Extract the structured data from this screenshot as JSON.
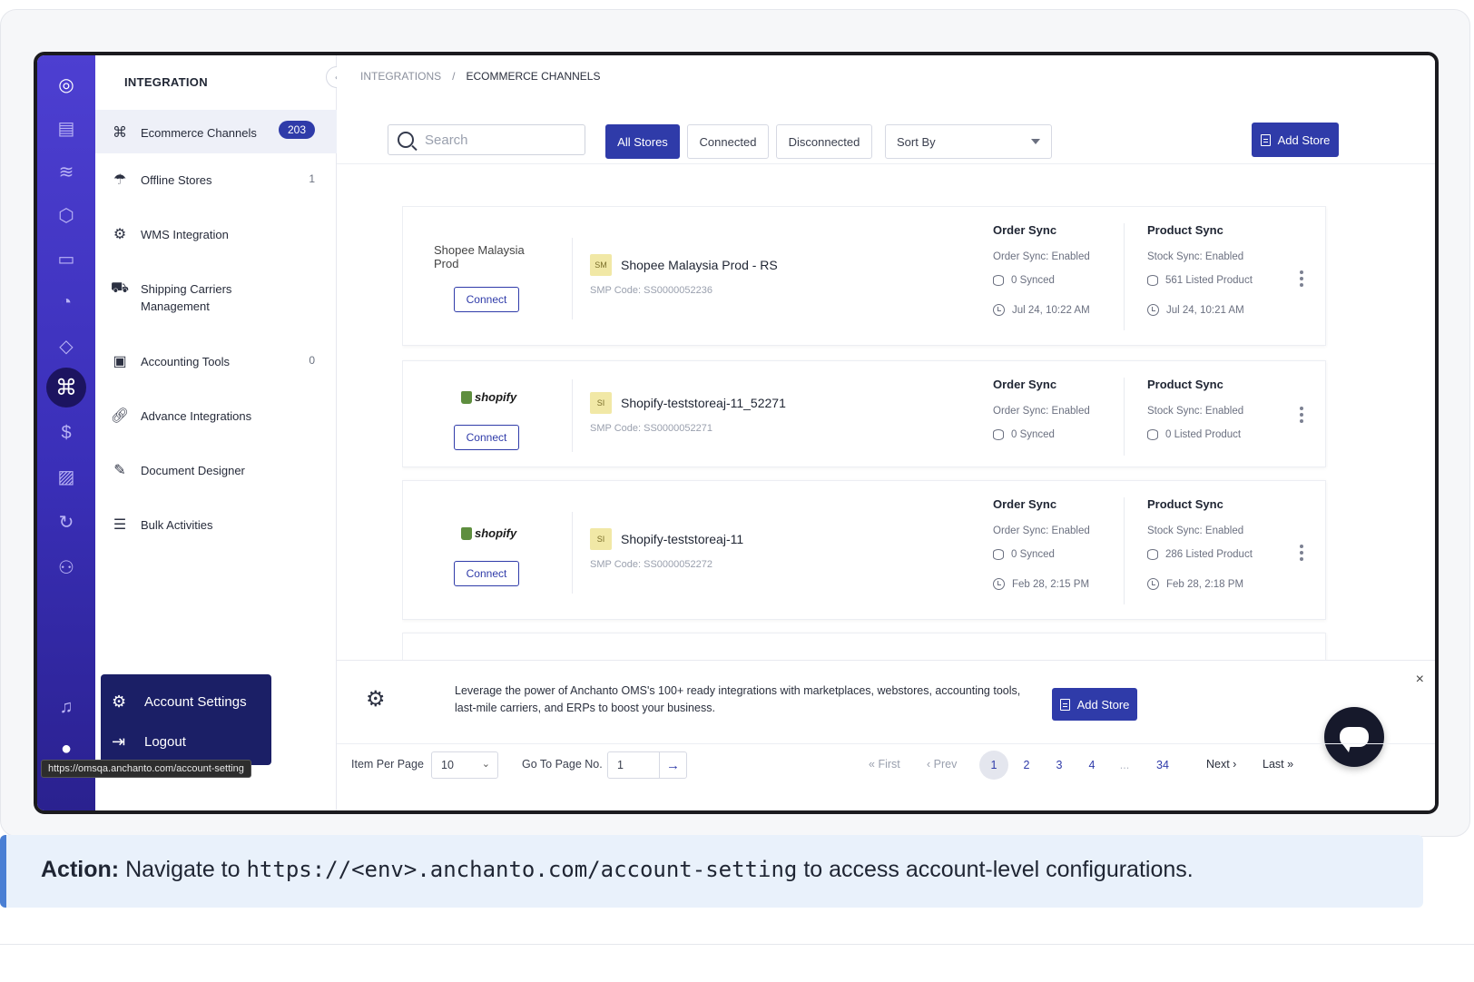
{
  "breadcrumb": {
    "root": "INTEGRATIONS",
    "separator": "/",
    "current": "ECOMMERCE CHANNELS"
  },
  "sidebar": {
    "title": "INTEGRATION",
    "items": [
      {
        "label": "Ecommerce Channels",
        "count": "203",
        "icon": "command-icon"
      },
      {
        "label": "Offline Stores",
        "count": "1",
        "icon": "umbrella-icon"
      },
      {
        "label": "WMS Integration",
        "count": "",
        "icon": "gear-icon"
      },
      {
        "label": "Shipping Carriers Management",
        "count": "",
        "icon": "truck-icon"
      },
      {
        "label": "Accounting Tools",
        "count": "0",
        "icon": "cash-icon"
      },
      {
        "label": "Advance Integrations",
        "count": "",
        "icon": "link-icon"
      },
      {
        "label": "Document Designer",
        "count": "",
        "icon": "edit-icon"
      },
      {
        "label": "Bulk Activities",
        "count": "",
        "icon": "list-icon"
      }
    ]
  },
  "account_menu": {
    "settings": "Account Settings",
    "logout": "Logout"
  },
  "url_tooltip": "https://omsqa.anchanto.com/account-setting",
  "toolbar": {
    "search_placeholder": "Search",
    "filters": [
      "All Stores",
      "Connected",
      "Disconnected"
    ],
    "sort_label": "Sort By",
    "add_store": "Add Store"
  },
  "stores": [
    {
      "logo_alt": "Shopee Malaysia Prod",
      "connect": "Connect",
      "badge": "SM",
      "name": "Shopee Malaysia Prod - RS",
      "code": "SMP Code: SS0000052236",
      "order_sync": {
        "title": "Order Sync",
        "status": "Order Sync: Enabled",
        "count": "0 Synced",
        "time": "Jul 24, 10:22 AM"
      },
      "product_sync": {
        "title": "Product Sync",
        "status": "Stock Sync: Enabled",
        "count": "561 Listed Product",
        "time": "Jul 24, 10:21 AM"
      }
    },
    {
      "logo_alt": "shopify",
      "connect": "Connect",
      "badge": "SI",
      "name": "Shopify-teststoreaj-11_52271",
      "code": "SMP Code: SS0000052271",
      "order_sync": {
        "title": "Order Sync",
        "status": "Order Sync: Enabled",
        "count": "0 Synced",
        "time": ""
      },
      "product_sync": {
        "title": "Product Sync",
        "status": "Stock Sync: Enabled",
        "count": "0 Listed Product",
        "time": ""
      }
    },
    {
      "logo_alt": "shopify",
      "connect": "Connect",
      "badge": "SI",
      "name": "Shopify-teststoreaj-11",
      "code": "SMP Code: SS0000052272",
      "order_sync": {
        "title": "Order Sync",
        "status": "Order Sync: Enabled",
        "count": "0 Synced",
        "time": "Feb 28, 2:15 PM"
      },
      "product_sync": {
        "title": "Product Sync",
        "status": "Stock Sync: Enabled",
        "count": "286 Listed Product",
        "time": "Feb 28, 2:18 PM"
      }
    }
  ],
  "banner": {
    "text": "Leverage the power of Anchanto OMS's 100+ ready integrations with marketplaces, webstores, accounting tools, last-mile carriers, and ERPs to boost your business.",
    "button": "Add Store",
    "close": "×"
  },
  "pagination": {
    "items_per_page_label": "Item Per Page",
    "items_per_page": "10",
    "goto_label": "Go To Page No.",
    "goto_value": "1",
    "first": "First",
    "prev": "Prev",
    "pages": [
      "1",
      "2",
      "3",
      "4",
      "...",
      "34"
    ],
    "current_page": "1",
    "next": "Next",
    "last": "Last"
  },
  "action": {
    "label": "Action:",
    "prefix": "Navigate to",
    "url": "https://<env>.anchanto.com/account-setting",
    "suffix": "to access account-level configurations."
  },
  "colors": {
    "primary": "#2f3ba9",
    "rail": "#4d3fd1",
    "menu_bg": "#1b1f66",
    "action_bg": "#e9f1fb",
    "action_border": "#4a7fd4"
  }
}
